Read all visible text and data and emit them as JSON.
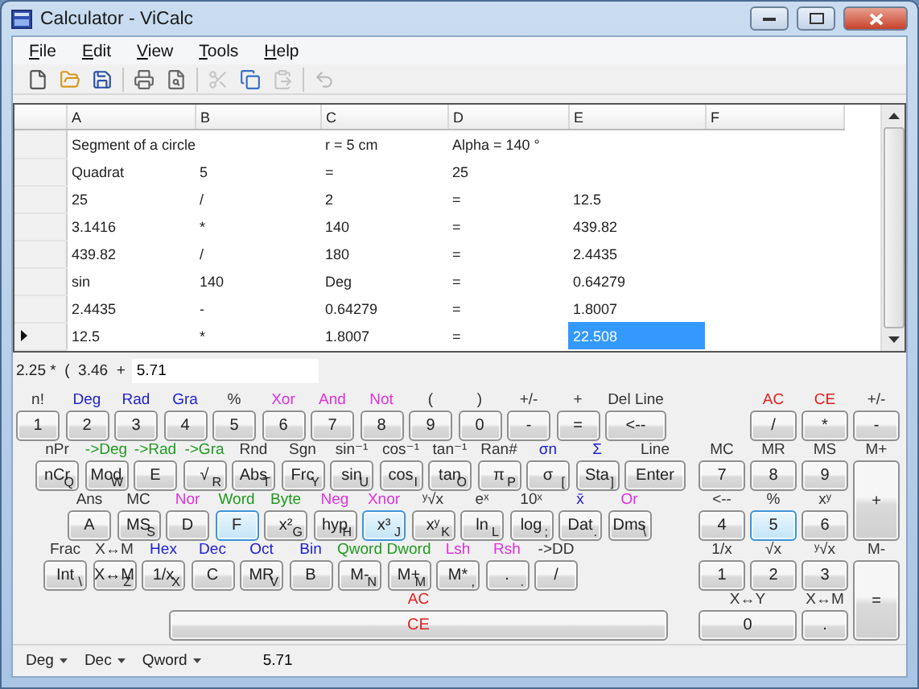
{
  "window": {
    "title": "Calculator - ViCalc"
  },
  "menu": [
    {
      "label": "File"
    },
    {
      "label": "Edit"
    },
    {
      "label": "View"
    },
    {
      "label": "Tools"
    },
    {
      "label": "Help"
    }
  ],
  "toolbar": [
    {
      "kind": "new",
      "disabled": false
    },
    {
      "kind": "open",
      "disabled": false
    },
    {
      "kind": "save",
      "disabled": false
    },
    {
      "kind": "separator"
    },
    {
      "kind": "print",
      "disabled": false
    },
    {
      "kind": "preview",
      "disabled": false
    },
    {
      "kind": "separator"
    },
    {
      "kind": "cut",
      "disabled": true
    },
    {
      "kind": "copy",
      "disabled": false
    },
    {
      "kind": "paste",
      "disabled": true
    },
    {
      "kind": "separator"
    },
    {
      "kind": "undo",
      "disabled": true
    }
  ],
  "sheet": {
    "columns": [
      "A",
      "B",
      "C",
      "D",
      "E",
      "F"
    ],
    "rows": [
      {
        "current": false,
        "cells": [
          {
            "text": "Segment of a circle",
            "selected": false
          },
          {
            "selected": false
          },
          {
            "text": "r = 5 cm",
            "selected": false
          },
          {
            "text": "Alpha = 140 °",
            "selected": false
          },
          {
            "selected": false
          },
          {
            "selected": false
          }
        ]
      },
      {
        "current": false,
        "cells": [
          {
            "text": "Quadrat",
            "selected": false
          },
          {
            "text": "5",
            "selected": false
          },
          {
            "text": "=",
            "selected": false
          },
          {
            "text": "25",
            "selected": false
          },
          {
            "selected": false
          },
          {
            "selected": false
          }
        ]
      },
      {
        "current": false,
        "cells": [
          {
            "text": "25",
            "selected": false
          },
          {
            "text": "/",
            "selected": false
          },
          {
            "text": "2",
            "selected": false
          },
          {
            "text": "=",
            "selected": false
          },
          {
            "text": "12.5",
            "selected": false
          },
          {
            "selected": false
          }
        ]
      },
      {
        "current": false,
        "cells": [
          {
            "text": "3.1416",
            "selected": false
          },
          {
            "text": "*",
            "selected": false
          },
          {
            "text": "140",
            "selected": false
          },
          {
            "text": "=",
            "selected": false
          },
          {
            "text": "439.82",
            "selected": false
          },
          {
            "selected": false
          }
        ]
      },
      {
        "current": false,
        "cells": [
          {
            "text": "439.82",
            "selected": false
          },
          {
            "text": "/",
            "selected": false
          },
          {
            "text": "180",
            "selected": false
          },
          {
            "text": "=",
            "selected": false
          },
          {
            "text": "2.4435",
            "selected": false
          },
          {
            "selected": false
          }
        ]
      },
      {
        "current": false,
        "cells": [
          {
            "text": "sin",
            "selected": false
          },
          {
            "text": "140",
            "selected": false
          },
          {
            "text": "Deg",
            "selected": false
          },
          {
            "text": "=",
            "selected": false
          },
          {
            "text": "0.64279",
            "selected": false
          },
          {
            "selected": false
          }
        ]
      },
      {
        "current": false,
        "cells": [
          {
            "text": "2.4435",
            "selected": false
          },
          {
            "text": "-",
            "selected": false
          },
          {
            "text": "0.64279",
            "selected": false
          },
          {
            "text": "=",
            "selected": false
          },
          {
            "text": "1.8007",
            "selected": false
          },
          {
            "selected": false
          }
        ]
      },
      {
        "current": true,
        "cells": [
          {
            "text": "12.5",
            "selected": false
          },
          {
            "text": "*",
            "selected": false
          },
          {
            "text": "1.8007",
            "selected": false
          },
          {
            "text": "=",
            "selected": false
          },
          {
            "text": "22.508",
            "selected": true
          },
          {
            "selected": false
          }
        ]
      }
    ]
  },
  "expression": {
    "text": "2.25 *  (  3.46  +",
    "input": "5.71"
  },
  "left_keypad": {
    "rows": [
      {
        "keys": [
          {
            "top": "n!",
            "color": "#333333",
            "label": "1",
            "highlighted": false
          },
          {
            "top": "Deg",
            "color": "#2020d0",
            "label": "2",
            "highlighted": false
          },
          {
            "top": "Rad",
            "color": "#2020d0",
            "label": "3",
            "highlighted": false
          },
          {
            "top": "Gra",
            "color": "#2020d0",
            "label": "4",
            "highlighted": false
          },
          {
            "top": "%",
            "color": "#333333",
            "label": "5",
            "highlighted": false
          },
          {
            "top": "Xor",
            "color": "#e030e0",
            "label": "6",
            "highlighted": false
          },
          {
            "top": "And",
            "color": "#e030e0",
            "label": "7",
            "highlighted": false
          },
          {
            "top": "Not",
            "color": "#e030e0",
            "label": "8",
            "highlighted": false
          },
          {
            "top": "(",
            "color": "#333333",
            "label": "9",
            "highlighted": false
          },
          {
            "top": ")",
            "color": "#333333",
            "label": "0",
            "highlighted": false
          },
          {
            "top": "+/-",
            "color": "#333333",
            "label": "-",
            "highlighted": false
          },
          {
            "top": "+",
            "color": "#333333",
            "label": "=",
            "highlighted": false
          },
          {
            "top": "Del Line",
            "color": "#333333",
            "label": "<--",
            "highlighted": false
          }
        ]
      },
      {
        "keys": [
          {
            "top": "nPr",
            "color": "#333333",
            "label": "nCr",
            "sub": "Q",
            "highlighted": false
          },
          {
            "top": "->Deg",
            "color": "#1f9a1f",
            "label": "Mod",
            "sub": "W",
            "highlighted": false
          },
          {
            "top": "->Rad",
            "color": "#1f9a1f",
            "label": "E",
            "highlighted": false
          },
          {
            "top": "->Gra",
            "color": "#1f9a1f",
            "label": "√",
            "sub": "R",
            "highlighted": false
          },
          {
            "top": "Rnd",
            "color": "#333333",
            "label": "Abs",
            "sub": "T",
            "highlighted": false
          },
          {
            "top": "Sgn",
            "color": "#333333",
            "label": "Frc",
            "sub": "Y",
            "highlighted": false
          },
          {
            "top": "sin⁻¹",
            "color": "#333333",
            "label": "sin",
            "sub": "U",
            "highlighted": false
          },
          {
            "top": "cos⁻¹",
            "color": "#333333",
            "label": "cos",
            "sub": "I",
            "highlighted": false
          },
          {
            "top": "tan⁻¹",
            "color": "#333333",
            "label": "tan",
            "sub": "O",
            "highlighted": false
          },
          {
            "top": "Ran#",
            "color": "#333333",
            "label": "π",
            "sub": "P",
            "highlighted": false
          },
          {
            "top": "σn",
            "color": "#2020d0",
            "label": "σ",
            "sub": "[",
            "highlighted": false
          },
          {
            "top": "Σ",
            "color": "#2020d0",
            "label": "Sta",
            "sub": "]",
            "highlighted": false
          },
          {
            "top": "Line",
            "color": "#333333",
            "label": "Enter",
            "highlighted": false
          }
        ]
      },
      {
        "keys": [
          {
            "top": "Ans",
            "color": "#333333",
            "label": "A",
            "highlighted": false
          },
          {
            "top": "MC",
            "color": "#333333",
            "label": "MS",
            "sub": "S",
            "highlighted": false
          },
          {
            "top": "Nor",
            "color": "#e030e0",
            "label": "D",
            "highlighted": false
          },
          {
            "top": "Word",
            "color": "#1f9a1f",
            "label": "F",
            "highlighted": true
          },
          {
            "top": "Byte",
            "color": "#1f9a1f",
            "label": "x²",
            "sub": "G",
            "highlighted": false
          },
          {
            "top": "Neg",
            "color": "#e030e0",
            "label": "hyp",
            "sub": "H",
            "highlighted": false
          },
          {
            "top": "Xnor",
            "color": "#e030e0",
            "label": "x³",
            "sub": "J",
            "highlighted": true
          },
          {
            "top": "ʸ√x",
            "color": "#333333",
            "label": "xʸ",
            "sub": "K",
            "highlighted": false
          },
          {
            "top": "eˣ",
            "color": "#333333",
            "label": "ln",
            "sub": "L",
            "highlighted": false
          },
          {
            "top": "10ˣ",
            "color": "#333333",
            "label": "log",
            "sub": ";",
            "highlighted": false
          },
          {
            "top": "x̄",
            "color": "#2020d0",
            "label": "Dat",
            "sub": ".",
            "highlighted": false
          },
          {
            "top": "Or",
            "color": "#e030e0",
            "label": "Dms",
            "sub": "\\",
            "highlighted": false
          }
        ]
      },
      {
        "keys": [
          {
            "top": "Frac",
            "color": "#333333",
            "label": "Int",
            "sub": "\\",
            "highlighted": false
          },
          {
            "top": "X↔M",
            "color": "#333333",
            "label": "X↔M",
            "sub": "Z",
            "highlighted": false
          },
          {
            "top": "Hex",
            "color": "#2020d0",
            "label": "1/x",
            "sub": "X",
            "highlighted": false
          },
          {
            "top": "Dec",
            "color": "#2020d0",
            "label": "C",
            "highlighted": false
          },
          {
            "top": "Oct",
            "color": "#2020d0",
            "label": "MR",
            "sub": "V",
            "highlighted": false
          },
          {
            "top": "Bin",
            "color": "#2020d0",
            "label": "B",
            "highlighted": false
          },
          {
            "top": "Qword",
            "color": "#1f9a1f",
            "label": "M-",
            "sub": "N",
            "highlighted": false
          },
          {
            "top": "Dword",
            "color": "#1f9a1f",
            "label": "M+",
            "sub": "M",
            "highlighted": false
          },
          {
            "top": "Lsh",
            "color": "#e030e0",
            "label": "M*",
            "sub": ",",
            "highlighted": false
          },
          {
            "top": "Rsh",
            "color": "#e030e0",
            "label": ".",
            "sub": ".",
            "highlighted": false
          },
          {
            "top": "->DD",
            "color": "#333333",
            "label": "/",
            "highlighted": false
          }
        ]
      }
    ],
    "clear": {
      "top": "AC",
      "label": "CE",
      "color": "#e02020"
    }
  },
  "right_keypad": [
    {
      "top": "AC",
      "color": "#e02020",
      "label": "/",
      "kind": "normal",
      "highlighted": false
    },
    {
      "top": "CE",
      "color": "#e02020",
      "label": "*",
      "kind": "normal",
      "highlighted": false
    },
    {
      "top": "+/-",
      "color": "#333333",
      "label": "-",
      "kind": "normal",
      "highlighted": false
    },
    {
      "top": "MC",
      "color": "#333333",
      "label": "7",
      "kind": "normal",
      "highlighted": false
    },
    {
      "top": "MR",
      "color": "#333333",
      "label": "8",
      "kind": "normal",
      "highlighted": false
    },
    {
      "top": "MS",
      "color": "#333333",
      "label": "9",
      "kind": "normal",
      "highlighted": false
    },
    {
      "top": "M+",
      "color": "#333333",
      "label": "+",
      "kind": "tall",
      "highlighted": false
    },
    {
      "top": "<--",
      "color": "#333333",
      "label": "4",
      "kind": "normal",
      "highlighted": false
    },
    {
      "top": "%",
      "color": "#333333",
      "label": "5",
      "kind": "normal",
      "highlighted": true
    },
    {
      "top": "xʸ",
      "color": "#333333",
      "label": "6",
      "kind": "normal",
      "highlighted": false
    },
    {
      "top": "1/x",
      "color": "#333333",
      "label": "1",
      "kind": "normal",
      "highlighted": false
    },
    {
      "top": "√x",
      "color": "#333333",
      "label": "2",
      "kind": "normal",
      "highlighted": false
    },
    {
      "top": "ʸ√x",
      "color": "#333333",
      "label": "3",
      "kind": "normal",
      "highlighted": false
    },
    {
      "top": "M-",
      "color": "#333333",
      "label": "=",
      "kind": "tall",
      "highlighted": false
    },
    {
      "top": "X↔Y",
      "color": "#333333",
      "label": "0",
      "kind": "wide",
      "highlighted": false
    },
    {
      "top": "X↔M",
      "color": "#333333",
      "label": ".",
      "kind": "normal",
      "highlighted": false
    }
  ],
  "status_bar": {
    "dropdowns": [
      "Deg",
      "Dec",
      "Qword"
    ],
    "value": "5.71"
  }
}
